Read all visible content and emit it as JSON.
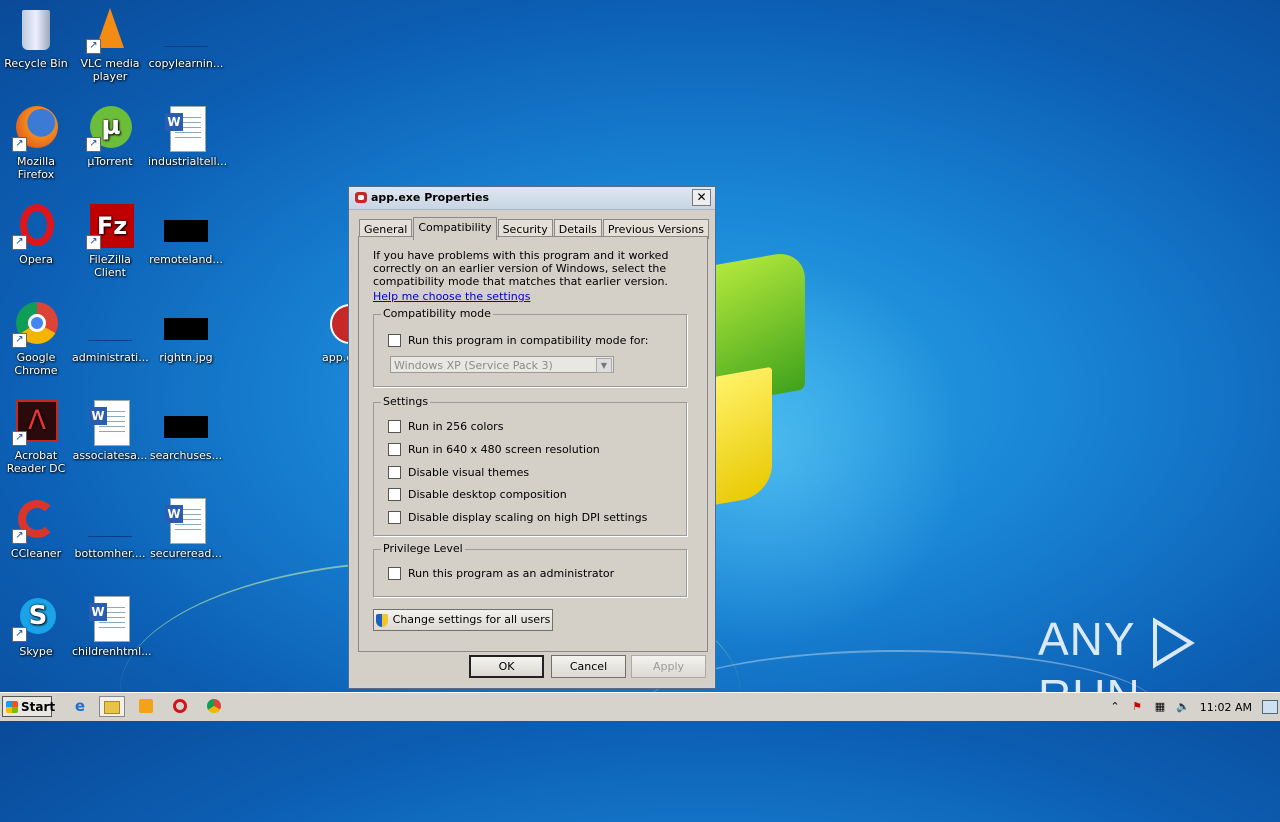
{
  "desktop": {
    "icons": [
      {
        "label": "Recycle Bin"
      },
      {
        "label": "VLC media player"
      },
      {
        "label": "copylearnin..."
      },
      {
        "label": "Mozilla Firefox"
      },
      {
        "label": "µTorrent"
      },
      {
        "label": "industrialtell..."
      },
      {
        "label": "Opera"
      },
      {
        "label": "FileZilla Client"
      },
      {
        "label": "remoteland..."
      },
      {
        "label": "Google Chrome"
      },
      {
        "label": "administrati..."
      },
      {
        "label": "rightn.jpg"
      },
      {
        "label": "app.exe"
      },
      {
        "label": "Acrobat Reader DC"
      },
      {
        "label": "associatesa..."
      },
      {
        "label": "searchuses..."
      },
      {
        "label": "CCleaner"
      },
      {
        "label": "bottomher...."
      },
      {
        "label": "secureread..."
      },
      {
        "label": "Skype"
      },
      {
        "label": "childrenhtml..."
      }
    ]
  },
  "dialog": {
    "title": "app.exe Properties",
    "close_label": "✕",
    "tabs": [
      {
        "label": "General"
      },
      {
        "label": "Compatibility"
      },
      {
        "label": "Security"
      },
      {
        "label": "Details"
      },
      {
        "label": "Previous Versions"
      }
    ],
    "intro": "If you have problems with this program and it worked correctly on an earlier version of Windows, select the compatibility mode that matches that earlier version.",
    "help_link": "Help me choose the settings",
    "compat_group": {
      "legend": "Compatibility mode",
      "checkbox": "Run this program in compatibility mode for:",
      "checked": false,
      "select_value": "Windows XP (Service Pack 3)"
    },
    "settings_group": {
      "legend": "Settings",
      "options": [
        {
          "label": "Run in 256 colors",
          "checked": false
        },
        {
          "label": "Run in 640 x 480 screen resolution",
          "checked": false
        },
        {
          "label": "Disable visual themes",
          "checked": false
        },
        {
          "label": "Disable desktop composition",
          "checked": false
        },
        {
          "label": "Disable display scaling on high DPI settings",
          "checked": false
        }
      ]
    },
    "privilege_group": {
      "legend": "Privilege Level",
      "checkbox": "Run this program as an administrator",
      "checked": false
    },
    "change_settings_button": "Change settings for all users",
    "ok_button": "OK",
    "cancel_button": "Cancel",
    "apply_button": "Apply"
  },
  "taskbar": {
    "start_label": "Start",
    "clock": "11:02 AM"
  },
  "watermark": {
    "left": "ANY",
    "right": "RUN"
  }
}
